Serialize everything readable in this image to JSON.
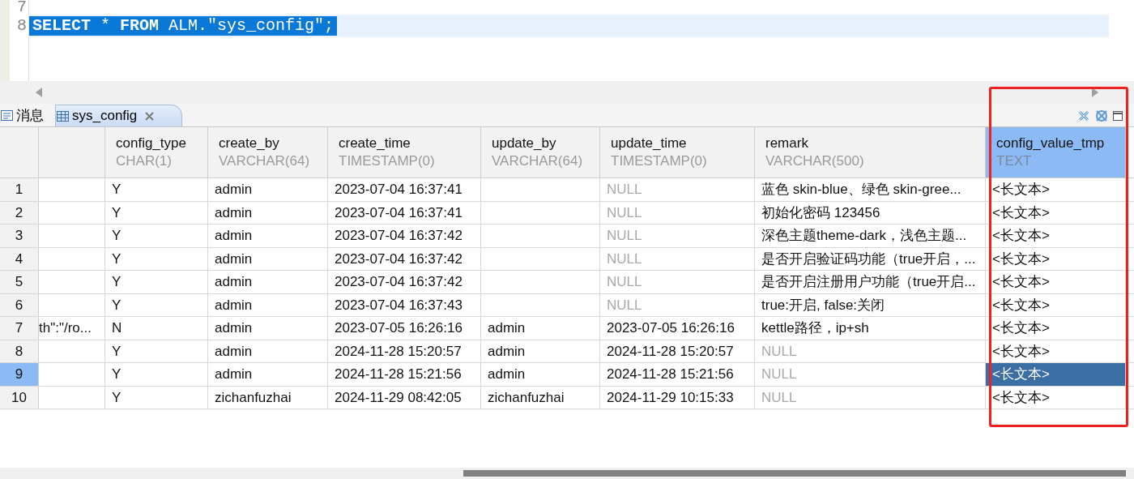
{
  "editor": {
    "lines": [
      {
        "number": "7"
      },
      {
        "number": "8",
        "text": "**SELECT** * **FROM** ALM.\"sys_config\";",
        "selected": true
      }
    ]
  },
  "tabs": [
    {
      "label": "消息",
      "kind": "messages",
      "selected": false
    },
    {
      "label": "sys_config",
      "kind": "table",
      "selected": true
    }
  ],
  "table": {
    "columns": [
      {
        "selected": false
      },
      {
        "name": "config_type",
        "type": "CHAR(1)",
        "selected": false
      },
      {
        "name": "create_by",
        "type": "VARCHAR(64)",
        "selected": false
      },
      {
        "name": "create_time",
        "type": "TIMESTAMP(0)",
        "selected": false
      },
      {
        "name": "update_by",
        "type": "VARCHAR(64)",
        "selected": false
      },
      {
        "name": "update_time",
        "type": "TIMESTAMP(0)",
        "selected": false
      },
      {
        "name": "remark",
        "type": "VARCHAR(500)",
        "selected": false
      },
      {
        "name": "config_value_tmp",
        "type": "TEXT",
        "selected": true
      }
    ],
    "rows": [
      {
        "number": "1",
        "selected": false,
        "cells": [
          null,
          {
            "text": "Y",
            "is_null": false
          },
          {
            "text": "admin",
            "is_null": false
          },
          {
            "text": "2023-07-04 16:37:41",
            "is_null": false
          },
          null,
          {
            "text": "NULL",
            "is_null": true
          },
          {
            "text": "蓝色 skin-blue、绿色 skin-gree...",
            "is_null": false
          },
          {
            "text": "<长文本>",
            "is_null": false
          }
        ]
      },
      {
        "number": "2",
        "selected": false,
        "cells": [
          null,
          {
            "text": "Y",
            "is_null": false
          },
          {
            "text": "admin",
            "is_null": false
          },
          {
            "text": "2023-07-04 16:37:41",
            "is_null": false
          },
          null,
          {
            "text": "NULL",
            "is_null": true
          },
          {
            "text": "初始化密码 123456",
            "is_null": false
          },
          {
            "text": "<长文本>",
            "is_null": false
          }
        ]
      },
      {
        "number": "3",
        "selected": false,
        "cells": [
          null,
          {
            "text": "Y",
            "is_null": false
          },
          {
            "text": "admin",
            "is_null": false
          },
          {
            "text": "2023-07-04 16:37:42",
            "is_null": false
          },
          null,
          {
            "text": "NULL",
            "is_null": true
          },
          {
            "text": "深色主题theme-dark，浅色主题...",
            "is_null": false
          },
          {
            "text": "<长文本>",
            "is_null": false
          }
        ]
      },
      {
        "number": "4",
        "selected": false,
        "cells": [
          null,
          {
            "text": "Y",
            "is_null": false
          },
          {
            "text": "admin",
            "is_null": false
          },
          {
            "text": "2023-07-04 16:37:42",
            "is_null": false
          },
          null,
          {
            "text": "NULL",
            "is_null": true
          },
          {
            "text": "是否开启验证码功能（true开启，...",
            "is_null": false
          },
          {
            "text": "<长文本>",
            "is_null": false
          }
        ]
      },
      {
        "number": "5",
        "selected": false,
        "cells": [
          null,
          {
            "text": "Y",
            "is_null": false
          },
          {
            "text": "admin",
            "is_null": false
          },
          {
            "text": "2023-07-04 16:37:42",
            "is_null": false
          },
          null,
          {
            "text": "NULL",
            "is_null": true
          },
          {
            "text": "是否开启注册用户功能（true开启...",
            "is_null": false
          },
          {
            "text": "<长文本>",
            "is_null": false
          }
        ]
      },
      {
        "number": "6",
        "selected": false,
        "cells": [
          null,
          {
            "text": "Y",
            "is_null": false
          },
          {
            "text": "admin",
            "is_null": false
          },
          {
            "text": "2023-07-04 16:37:43",
            "is_null": false
          },
          null,
          {
            "text": "NULL",
            "is_null": true
          },
          {
            "text": "true:开启, false:关闭",
            "is_null": false
          },
          {
            "text": "<长文本>",
            "is_null": false
          }
        ]
      },
      {
        "number": "7",
        "selected": false,
        "cells": [
          {
            "text": "th\":\"/ro...",
            "is_null": false
          },
          {
            "text": "N",
            "is_null": false
          },
          {
            "text": "admin",
            "is_null": false
          },
          {
            "text": "2023-07-05 16:26:16",
            "is_null": false
          },
          {
            "text": "admin",
            "is_null": false
          },
          {
            "text": "2023-07-05 16:26:16",
            "is_null": false
          },
          {
            "text": "kettle路径，ip+sh",
            "is_null": false
          },
          {
            "text": "<长文本>",
            "is_null": false
          }
        ]
      },
      {
        "number": "8",
        "selected": false,
        "cells": [
          null,
          {
            "text": "Y",
            "is_null": false
          },
          {
            "text": "admin",
            "is_null": false
          },
          {
            "text": "2024-11-28 15:20:57",
            "is_null": false
          },
          {
            "text": "admin",
            "is_null": false
          },
          {
            "text": "2024-11-28 15:20:57",
            "is_null": false
          },
          {
            "text": "NULL",
            "is_null": true
          },
          {
            "text": "<长文本>",
            "is_null": false
          }
        ]
      },
      {
        "number": "9",
        "selected": true,
        "cells": [
          null,
          {
            "text": "Y",
            "is_null": false
          },
          {
            "text": "admin",
            "is_null": false
          },
          {
            "text": "2024-11-28 15:21:56",
            "is_null": false
          },
          {
            "text": "admin",
            "is_null": false
          },
          {
            "text": "2024-11-28 15:21:56",
            "is_null": false
          },
          {
            "text": "NULL",
            "is_null": true
          },
          {
            "text": "<长文本>",
            "is_null": false
          }
        ]
      },
      {
        "number": "10",
        "selected": false,
        "cells": [
          null,
          {
            "text": "Y",
            "is_null": false
          },
          {
            "text": "zichanfuzhai",
            "is_null": false
          },
          {
            "text": "2024-11-29 08:42:05",
            "is_null": false
          },
          {
            "text": "zichanfuzhai",
            "is_null": false
          },
          {
            "text": "2024-11-29 10:15:33",
            "is_null": false
          },
          {
            "text": "NULL",
            "is_null": true
          },
          {
            "text": "<长文本>",
            "is_null": false
          }
        ]
      }
    ]
  }
}
